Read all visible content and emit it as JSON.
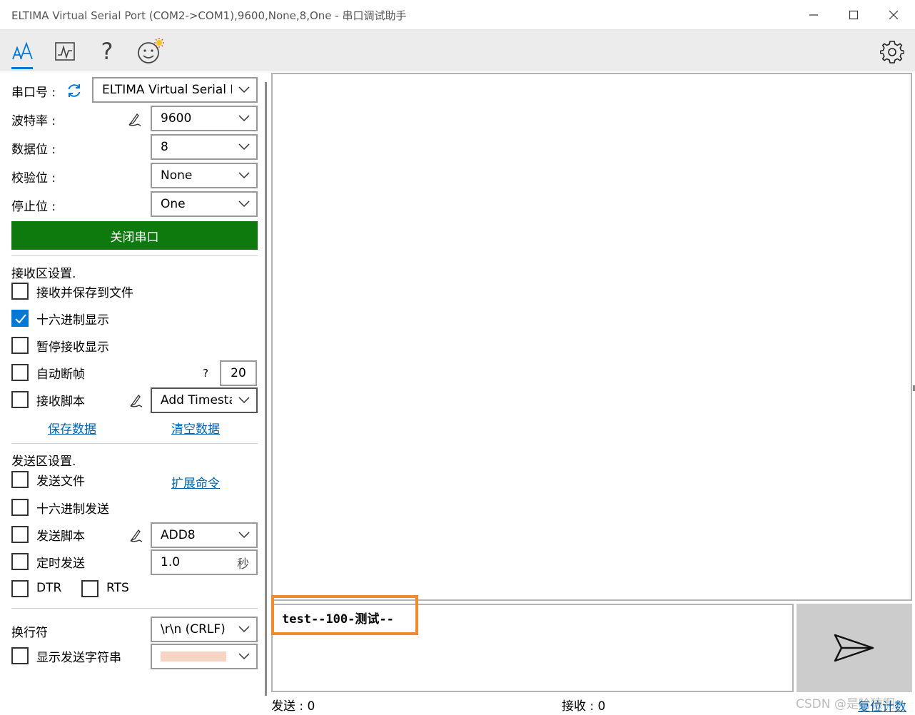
{
  "window": {
    "title": "ELTIMA Virtual Serial Port (COM2->COM1),9600,None,8,One - 串口调试助手"
  },
  "toolbar": {
    "icons": [
      "font-icon",
      "chart-icon",
      "help-icon",
      "emoji-icon",
      "gear-icon"
    ],
    "help_glyph": "?",
    "accent": "#0078d7"
  },
  "serial": {
    "port_label": "串口号 :",
    "port_value": "ELTIMA Virtual Serial Por",
    "baud_label": "波特率 :",
    "baud_value": "9600",
    "databits_label": "数据位 :",
    "databits_value": "8",
    "parity_label": "校验位 :",
    "parity_value": "None",
    "stopbits_label": "停止位 :",
    "stopbits_value": "One",
    "close_button": "关闭串口",
    "close_button_color": "#0e7a0e"
  },
  "receive": {
    "section_title": "接收区设置.",
    "save_to_file": "接收并保存到文件",
    "hex_display": "十六进制显示",
    "hex_display_checked": true,
    "pause_display": "暂停接收显示",
    "auto_frame": "自动断帧",
    "auto_frame_help": "?",
    "auto_frame_value": "20",
    "script": "接收脚本",
    "script_value": "Add Timesta",
    "save_data": "保存数据",
    "clear_data": "清空数据"
  },
  "send": {
    "section_title": "发送区设置.",
    "send_file": "发送文件",
    "extend_cmd": "扩展命令",
    "hex_send": "十六进制发送",
    "script": "发送脚本",
    "script_value": "ADD8",
    "timed_send": "定时发送",
    "timed_value": "1.0",
    "timed_unit": "秒",
    "dtr": "DTR",
    "rts": "RTS",
    "newline_label": "换行符",
    "newline_value": "\\r\\n (CRLF)",
    "show_string": "显示发送字符串",
    "input_text": "test--100-测试--"
  },
  "status": {
    "sent": "发送 : 0",
    "received": "接收 : 0",
    "reset": "复位计数",
    "watermark": "CSDN @是哈猿啊"
  },
  "colors": {
    "highlight": "#f08a2c",
    "swatch": "#f7d4c4"
  }
}
